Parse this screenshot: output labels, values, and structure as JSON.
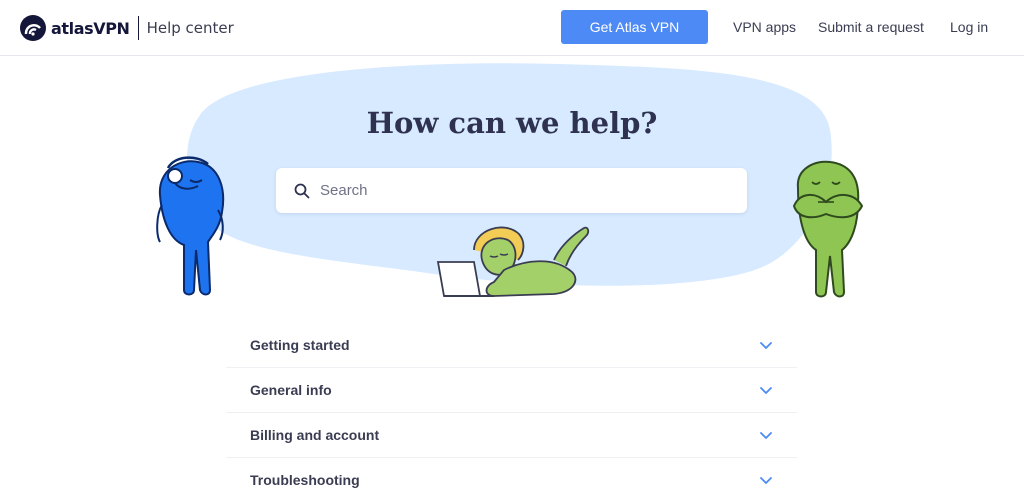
{
  "header": {
    "brand_name": "atlasVPN",
    "section_name": "Help center",
    "cta_label": "Get Atlas VPN",
    "nav": [
      "VPN apps",
      "Submit a request",
      "Log in"
    ]
  },
  "hero": {
    "title": "How can we help?",
    "search_placeholder": "Search"
  },
  "categories": [
    {
      "label": "Getting started",
      "icon": "chevron-down-icon"
    },
    {
      "label": "General info",
      "icon": "chevron-down-icon"
    },
    {
      "label": "Billing and account",
      "icon": "chevron-down-icon"
    },
    {
      "label": "Troubleshooting",
      "icon": "chevron-down-icon"
    }
  ],
  "colors": {
    "accent": "#4d8af5",
    "hero_background": "#d7eaff",
    "mascot_blue": "#1e74f0",
    "mascot_green": "#8fc653",
    "text_dark": "#2e3150"
  }
}
